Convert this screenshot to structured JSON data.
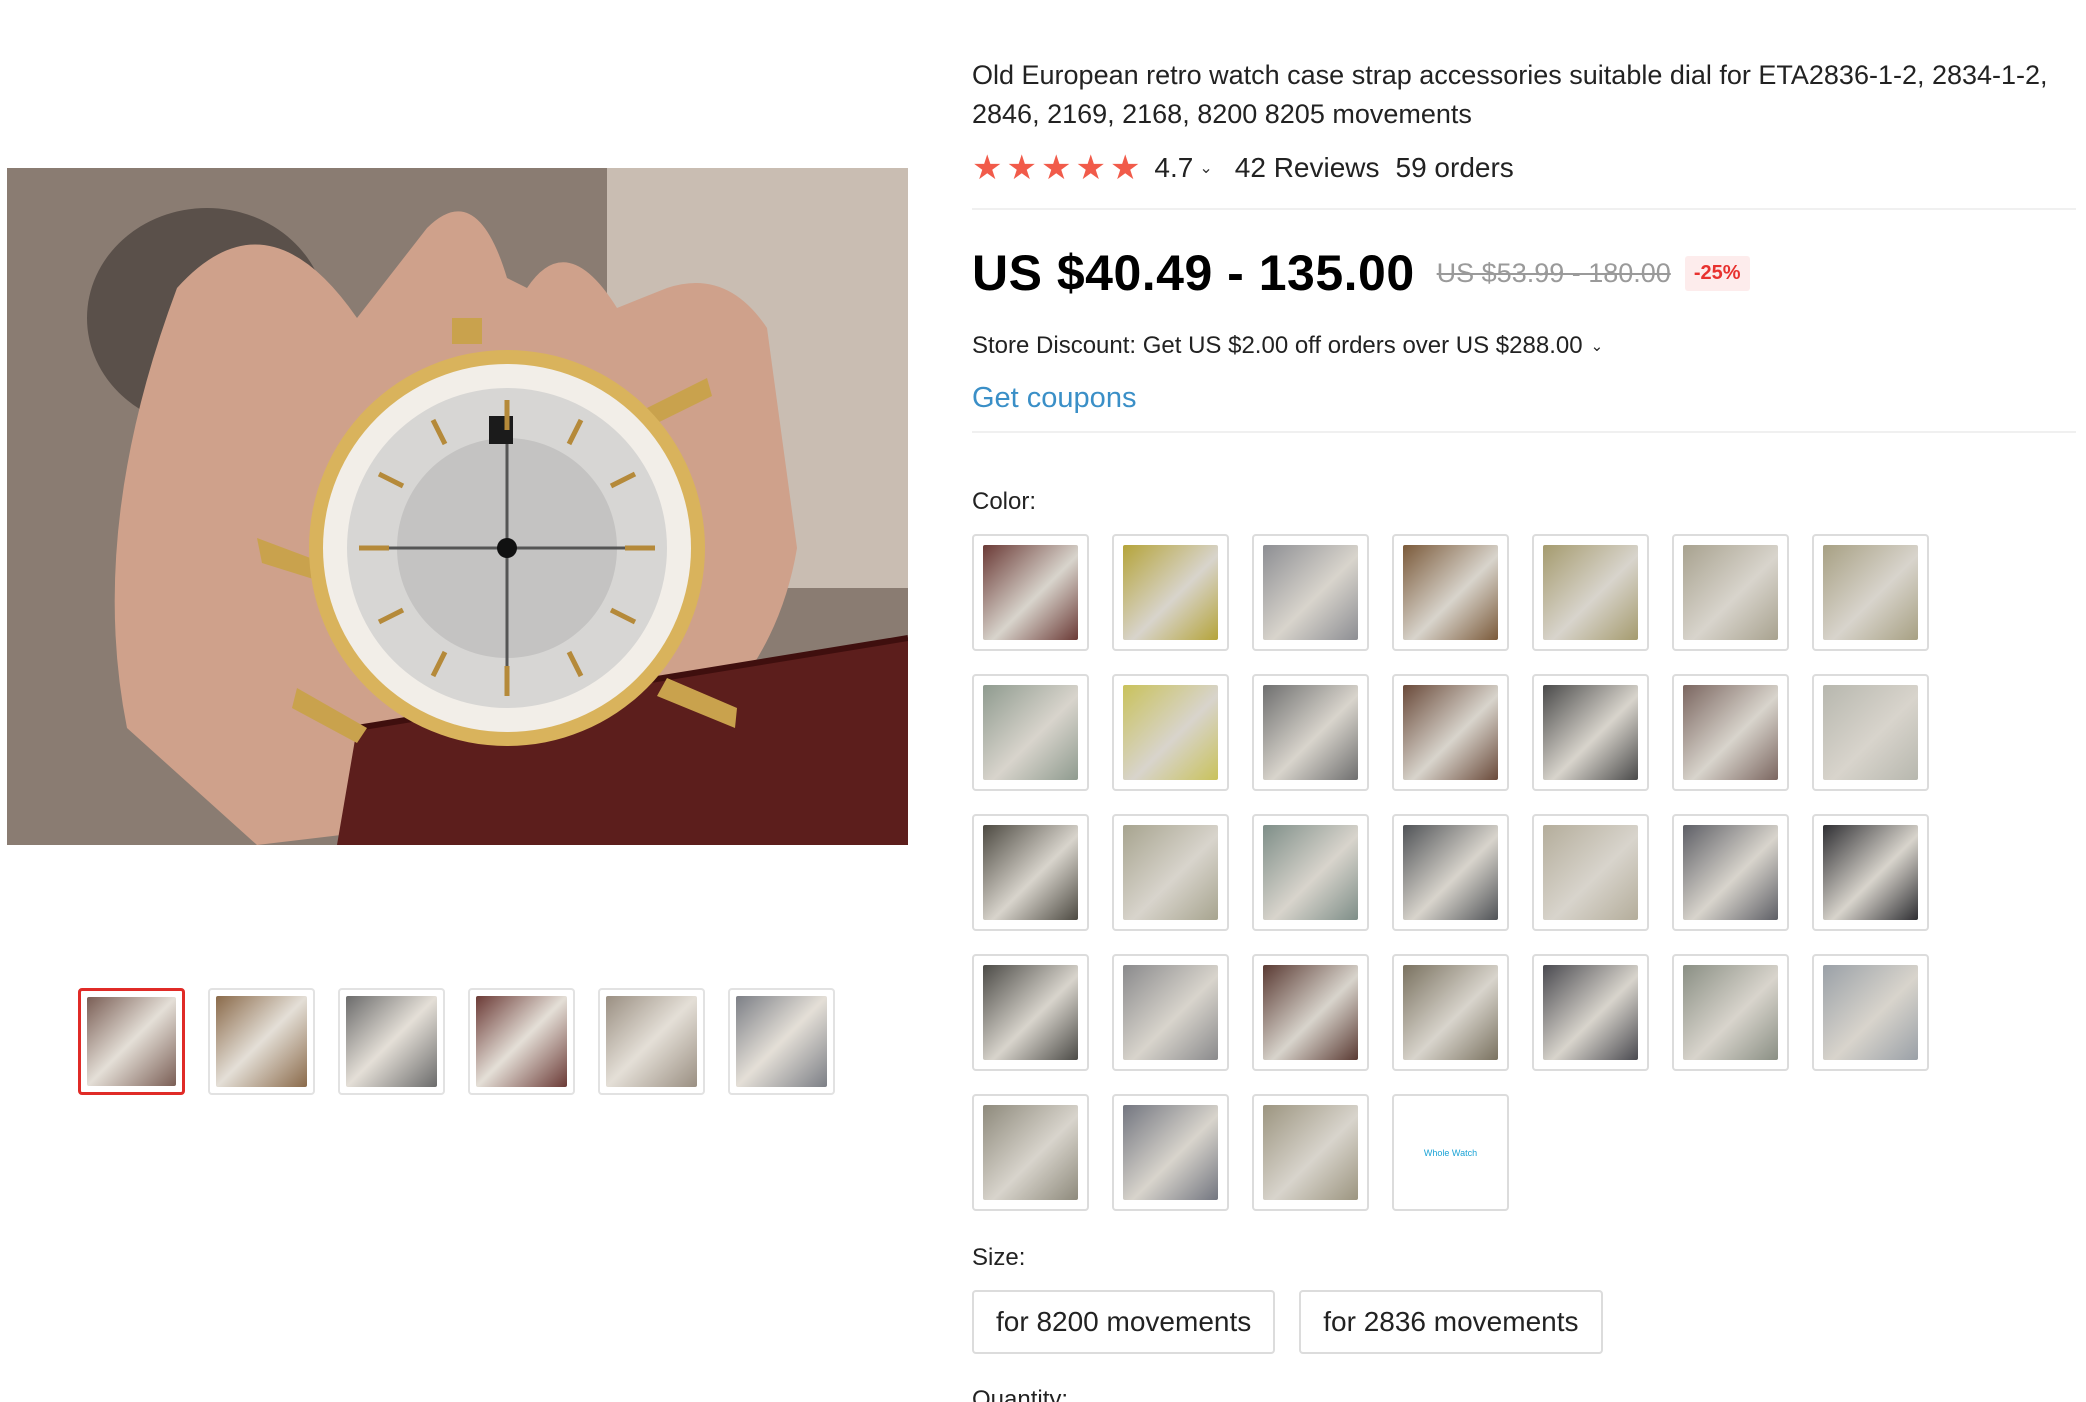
{
  "product": {
    "title": "Old European retro watch case strap accessories suitable dial for ETA2836-1-2, 2834-1-2, 2846, 2169, 2168, 8200 8205 movements"
  },
  "rating": {
    "stars": 5,
    "value": "4.7",
    "reviews": "42 Reviews",
    "orders": "59 orders"
  },
  "pricing": {
    "price": "US $40.49 - 135.00",
    "original_price": "US $53.99 - 180.00",
    "discount": "-25%"
  },
  "store_discount": {
    "text": "Store Discount: Get US $2.00 off orders over US $288.00"
  },
  "coupons": {
    "label": "Get coupons"
  },
  "color": {
    "label": "Color:",
    "options": [
      {
        "tone": "#6b3a36"
      },
      {
        "tone": "#b5a43a"
      },
      {
        "tone": "#8d8e93"
      },
      {
        "tone": "#7b5a3a"
      },
      {
        "tone": "#a59b6e"
      },
      {
        "tone": "#a8a28f"
      },
      {
        "tone": "#a7a083"
      },
      {
        "tone": "#8f9b8f"
      },
      {
        "tone": "#c9c25b"
      },
      {
        "tone": "#6f6f6f"
      },
      {
        "tone": "#6a4a3a"
      },
      {
        "tone": "#4a4a4a"
      },
      {
        "tone": "#7b6660"
      },
      {
        "tone": "#b7b7ae"
      },
      {
        "tone": "#4d4a42"
      },
      {
        "tone": "#a7a48f"
      },
      {
        "tone": "#7e8e88"
      },
      {
        "tone": "#505357"
      },
      {
        "tone": "#b4ad9b"
      },
      {
        "tone": "#5e5f66"
      },
      {
        "tone": "#2f2f33"
      },
      {
        "tone": "#4c4b47"
      },
      {
        "tone": "#8a8a8c"
      },
      {
        "tone": "#5a3a33"
      },
      {
        "tone": "#7a7260"
      },
      {
        "tone": "#4a4a50"
      },
      {
        "tone": "#8a8f84"
      },
      {
        "tone": "#9aa0a7"
      },
      {
        "tone": "#8e8a7c"
      },
      {
        "tone": "#737680"
      },
      {
        "tone": "#9c9580"
      }
    ],
    "text_option": {
      "label": "Whole Watch"
    }
  },
  "size": {
    "label": "Size:",
    "options": [
      "for 8200 movements",
      "for 2836 movements"
    ]
  },
  "quantity": {
    "label": "Quantity:"
  },
  "gallery": {
    "thumbnails": [
      {
        "tone": "#7a5e55"
      },
      {
        "tone": "#8a6a4a"
      },
      {
        "tone": "#6b6b6b"
      },
      {
        "tone": "#6b3a36"
      },
      {
        "tone": "#9a8f82"
      },
      {
        "tone": "#7c7f86"
      }
    ]
  },
  "colors": {
    "accent_red": "#e02b27",
    "star": "#f15b4a",
    "link_blue": "#3a8fc7",
    "discount_bg": "#fdecec"
  }
}
